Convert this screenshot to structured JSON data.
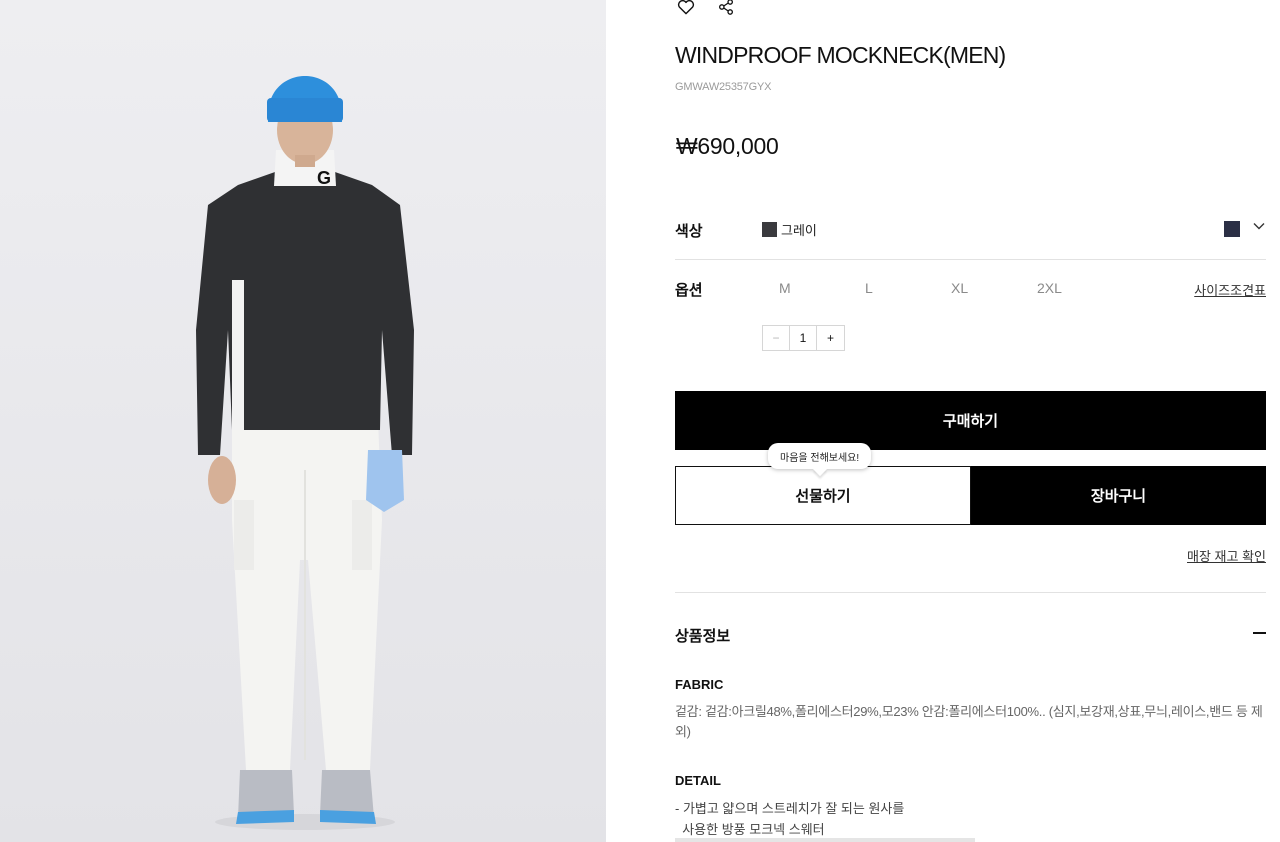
{
  "product": {
    "title": "WINDPROOF MOCKNECK(MEN)",
    "code": "GMWAW25357GYX",
    "price": "₩690,000"
  },
  "color": {
    "label": "색상",
    "value": "그레이",
    "swatch_hex": "#3a3a3e"
  },
  "options": {
    "label": "옵션",
    "sizes": [
      "M",
      "L",
      "XL",
      "2XL"
    ],
    "size_chart_link": "사이즈조견표"
  },
  "quantity": {
    "minus": "−",
    "value": "1",
    "plus": "+"
  },
  "buttons": {
    "buy": "구매하기",
    "gift": "선물하기",
    "gift_tooltip": "마음을 전해보세요!",
    "cart": "장바구니",
    "stock_check": "매장 재고 확인"
  },
  "info": {
    "title": "상품정보",
    "fabric_heading": "FABRIC",
    "fabric_text": "겉감: 겉감:아크릴48%,폴리에스터29%,모23% 안감:폴리에스터100%.. (심지,보강재,상표,무늬,레이스,밴드 등 제외)",
    "detail_heading": "DETAIL",
    "detail_text": "- 가볍고 얇으며 스트레치가 잘 되는 원사를\n  사용한 방풍 모크넥 스웨터"
  },
  "icons": {
    "wishlist": "heart-icon",
    "share": "share-icon",
    "dropdown": "chevron-down-icon",
    "collapse": "minus-icon"
  }
}
